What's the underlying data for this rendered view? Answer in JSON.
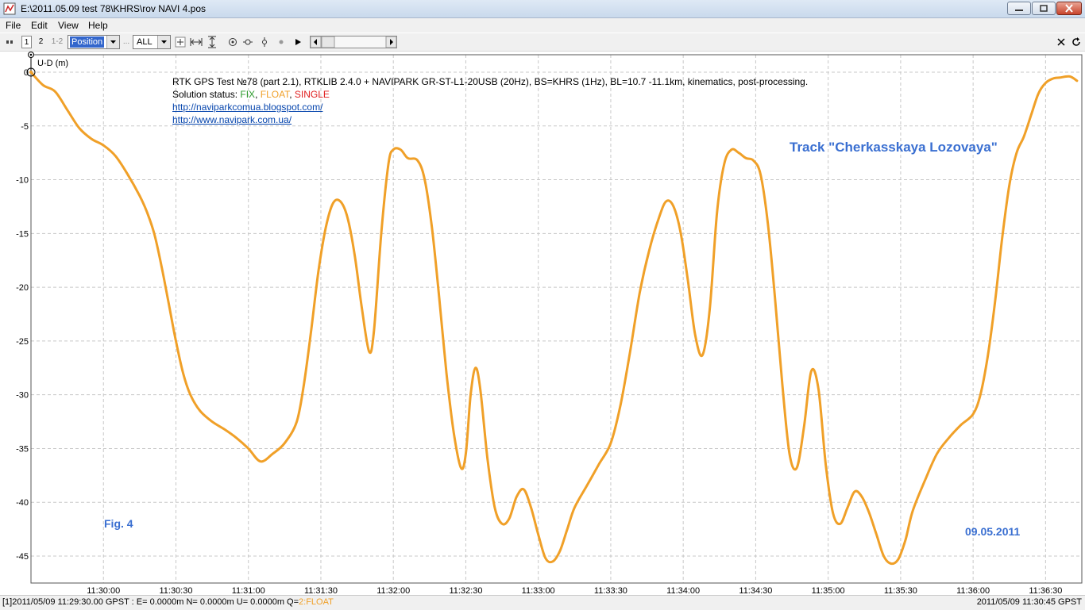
{
  "window": {
    "title": "E:\\2011.05.09 test 78\\KHRS\\rov NAVI 4.pos"
  },
  "menu": [
    "File",
    "Edit",
    "View",
    "Help"
  ],
  "toolbar": {
    "button_1": "1",
    "button_2": "2",
    "button_12": "1-2",
    "plot_type": "Position",
    "sat_filter": "ALL"
  },
  "annotations": {
    "header_line": "RTK GPS Test №78 (part 2.1), RTKLIB 2.4.0 + NAVIPARK GR-ST-L1-20USB (20Hz), BS=KHRS (1Hz), BL=10.7 -11.1km, kinematics, post-processing.",
    "solution_label": "Solution status: ",
    "status_fix": "FIX",
    "status_float": "FLOAT",
    "status_single": "SINGLE",
    "comma": ", ",
    "link1": "http://naviparkcomua.blogspot.com/",
    "link2": "http://www.navipark.com.ua/",
    "track_title": "Track \"Cherkasskaya Lozovaya\"",
    "fig": "Fig. 4",
    "date": "09.05.2011"
  },
  "status_bar": {
    "left_prefix": "[1]2011/05/09 11:29:30.00 GPST : E= 0.0000m N= 0.0000m U= 0.0000m Q=",
    "left_q": "2:FLOAT",
    "right": "2011/05/09 11:30:45 GPST"
  },
  "colors": {
    "fix": "#2e9b2e",
    "float": "#f0a028",
    "single": "#e02020",
    "grid": "#c8c8c8",
    "accent_text": "#3a6fd1"
  },
  "chart_data": {
    "type": "line",
    "ylabel": "U-D (m)",
    "xlabel": "",
    "title": "",
    "xlim": [
      "11:29:30",
      "11:36:45"
    ],
    "ylim": [
      -46.5,
      1
    ],
    "grid": true,
    "x_ticks": [
      "11:30:00",
      "11:30:30",
      "11:31:00",
      "11:31:30",
      "11:32:00",
      "11:32:30",
      "11:33:00",
      "11:33:30",
      "11:34:00",
      "11:34:30",
      "11:35:00",
      "11:35:30",
      "11:36:00",
      "11:36:30"
    ],
    "y_ticks": [
      0,
      -5,
      -10,
      -15,
      -20,
      -25,
      -30,
      -35,
      -40,
      -45
    ],
    "y_tick_labels": [
      "0",
      "-5",
      "-10",
      "-15",
      "-20",
      "-25",
      "-30",
      "-35",
      "-40",
      "-45"
    ],
    "series": [
      {
        "color": "#f0a028",
        "points": [
          [
            "11:29:30",
            0
          ],
          [
            "11:29:35",
            -1.2
          ],
          [
            "11:29:40",
            -1.8
          ],
          [
            "11:29:45",
            -3.5
          ],
          [
            "11:29:50",
            -5.2
          ],
          [
            "11:29:55",
            -6.2
          ],
          [
            "11:30:00",
            -6.8
          ],
          [
            "11:30:05",
            -7.8
          ],
          [
            "11:30:10",
            -9.5
          ],
          [
            "11:30:15",
            -11.5
          ],
          [
            "11:30:18",
            -13.0
          ],
          [
            "11:30:21",
            -15.0
          ],
          [
            "11:30:24",
            -18.0
          ],
          [
            "11:30:27",
            -21.5
          ],
          [
            "11:30:30",
            -25.0
          ],
          [
            "11:30:33",
            -28.0
          ],
          [
            "11:30:36",
            -30.0
          ],
          [
            "11:30:40",
            -31.5
          ],
          [
            "11:30:45",
            -32.5
          ],
          [
            "11:30:50",
            -33.2
          ],
          [
            "11:30:55",
            -34.0
          ],
          [
            "11:31:00",
            -35.0
          ],
          [
            "11:31:05",
            -36.2
          ],
          [
            "11:31:10",
            -35.5
          ],
          [
            "11:31:15",
            -34.5
          ],
          [
            "11:31:20",
            -32.5
          ],
          [
            "11:31:23",
            -29.0
          ],
          [
            "11:31:26",
            -24.0
          ],
          [
            "11:31:29",
            -18.5
          ],
          [
            "11:31:32",
            -14.5
          ],
          [
            "11:31:35",
            -12.2
          ],
          [
            "11:31:38",
            -12.0
          ],
          [
            "11:31:41",
            -13.5
          ],
          [
            "11:31:44",
            -17.0
          ],
          [
            "11:31:47",
            -22.0
          ],
          [
            "11:31:50",
            -26.0
          ],
          [
            "11:31:52",
            -24.0
          ],
          [
            "11:31:55",
            -15.0
          ],
          [
            "11:31:58",
            -8.5
          ],
          [
            "11:32:00",
            -7.2
          ],
          [
            "11:32:03",
            -7.2
          ],
          [
            "11:32:06",
            -8.0
          ],
          [
            "11:32:10",
            -8.2
          ],
          [
            "11:32:13",
            -10.0
          ],
          [
            "11:32:16",
            -14.5
          ],
          [
            "11:32:19",
            -21.0
          ],
          [
            "11:32:22",
            -28.0
          ],
          [
            "11:32:25",
            -33.5
          ],
          [
            "11:32:28",
            -36.8
          ],
          [
            "11:32:30",
            -35.5
          ],
          [
            "11:32:32",
            -30.0
          ],
          [
            "11:32:34",
            -27.5
          ],
          [
            "11:32:36",
            -29.5
          ],
          [
            "11:32:39",
            -36.0
          ],
          [
            "11:32:42",
            -40.5
          ],
          [
            "11:32:45",
            -42.0
          ],
          [
            "11:32:48",
            -41.5
          ],
          [
            "11:32:51",
            -39.5
          ],
          [
            "11:32:54",
            -38.8
          ],
          [
            "11:32:57",
            -40.5
          ],
          [
            "11:33:00",
            -43.0
          ],
          [
            "11:33:03",
            -45.2
          ],
          [
            "11:33:06",
            -45.5
          ],
          [
            "11:33:09",
            -44.5
          ],
          [
            "11:33:12",
            -42.5
          ],
          [
            "11:33:15",
            -40.5
          ],
          [
            "11:33:20",
            -38.5
          ],
          [
            "11:33:25",
            -36.5
          ],
          [
            "11:33:30",
            -34.5
          ],
          [
            "11:33:34",
            -31.0
          ],
          [
            "11:33:38",
            -26.0
          ],
          [
            "11:33:42",
            -20.5
          ],
          [
            "11:33:46",
            -16.5
          ],
          [
            "11:33:50",
            -13.5
          ],
          [
            "11:33:53",
            -12.0
          ],
          [
            "11:33:56",
            -12.5
          ],
          [
            "11:33:59",
            -15.0
          ],
          [
            "11:34:02",
            -19.5
          ],
          [
            "11:34:05",
            -24.5
          ],
          [
            "11:34:08",
            -26.3
          ],
          [
            "11:34:11",
            -22.0
          ],
          [
            "11:34:14",
            -13.0
          ],
          [
            "11:34:17",
            -8.5
          ],
          [
            "11:34:20",
            -7.2
          ],
          [
            "11:34:23",
            -7.5
          ],
          [
            "11:34:26",
            -8.0
          ],
          [
            "11:34:29",
            -8.2
          ],
          [
            "11:34:32",
            -9.5
          ],
          [
            "11:34:35",
            -14.0
          ],
          [
            "11:34:38",
            -21.0
          ],
          [
            "11:34:41",
            -29.0
          ],
          [
            "11:34:44",
            -35.5
          ],
          [
            "11:34:47",
            -36.8
          ],
          [
            "11:34:50",
            -33.0
          ],
          [
            "11:34:53",
            -27.8
          ],
          [
            "11:34:56",
            -29.5
          ],
          [
            "11:34:59",
            -36.5
          ],
          [
            "11:35:02",
            -41.0
          ],
          [
            "11:35:05",
            -42.0
          ],
          [
            "11:35:08",
            -40.5
          ],
          [
            "11:35:11",
            -39.0
          ],
          [
            "11:35:14",
            -39.5
          ],
          [
            "11:35:17",
            -41.0
          ],
          [
            "11:35:20",
            -43.0
          ],
          [
            "11:35:23",
            -45.0
          ],
          [
            "11:35:26",
            -45.7
          ],
          [
            "11:35:29",
            -45.3
          ],
          [
            "11:35:32",
            -43.5
          ],
          [
            "11:35:35",
            -40.8
          ],
          [
            "11:35:40",
            -38.0
          ],
          [
            "11:35:45",
            -35.5
          ],
          [
            "11:35:50",
            -34.0
          ],
          [
            "11:35:55",
            -32.8
          ],
          [
            "11:36:00",
            -31.8
          ],
          [
            "11:36:03",
            -30.0
          ],
          [
            "11:36:06",
            -26.5
          ],
          [
            "11:36:09",
            -21.5
          ],
          [
            "11:36:12",
            -15.5
          ],
          [
            "11:36:15",
            -10.5
          ],
          [
            "11:36:18",
            -7.5
          ],
          [
            "11:36:21",
            -6.0
          ],
          [
            "11:36:24",
            -4.0
          ],
          [
            "11:36:27",
            -2.0
          ],
          [
            "11:36:30",
            -1.0
          ],
          [
            "11:36:33",
            -0.6
          ],
          [
            "11:36:36",
            -0.5
          ],
          [
            "11:36:40",
            -0.4
          ],
          [
            "11:36:43",
            -0.8
          ]
        ]
      }
    ]
  }
}
